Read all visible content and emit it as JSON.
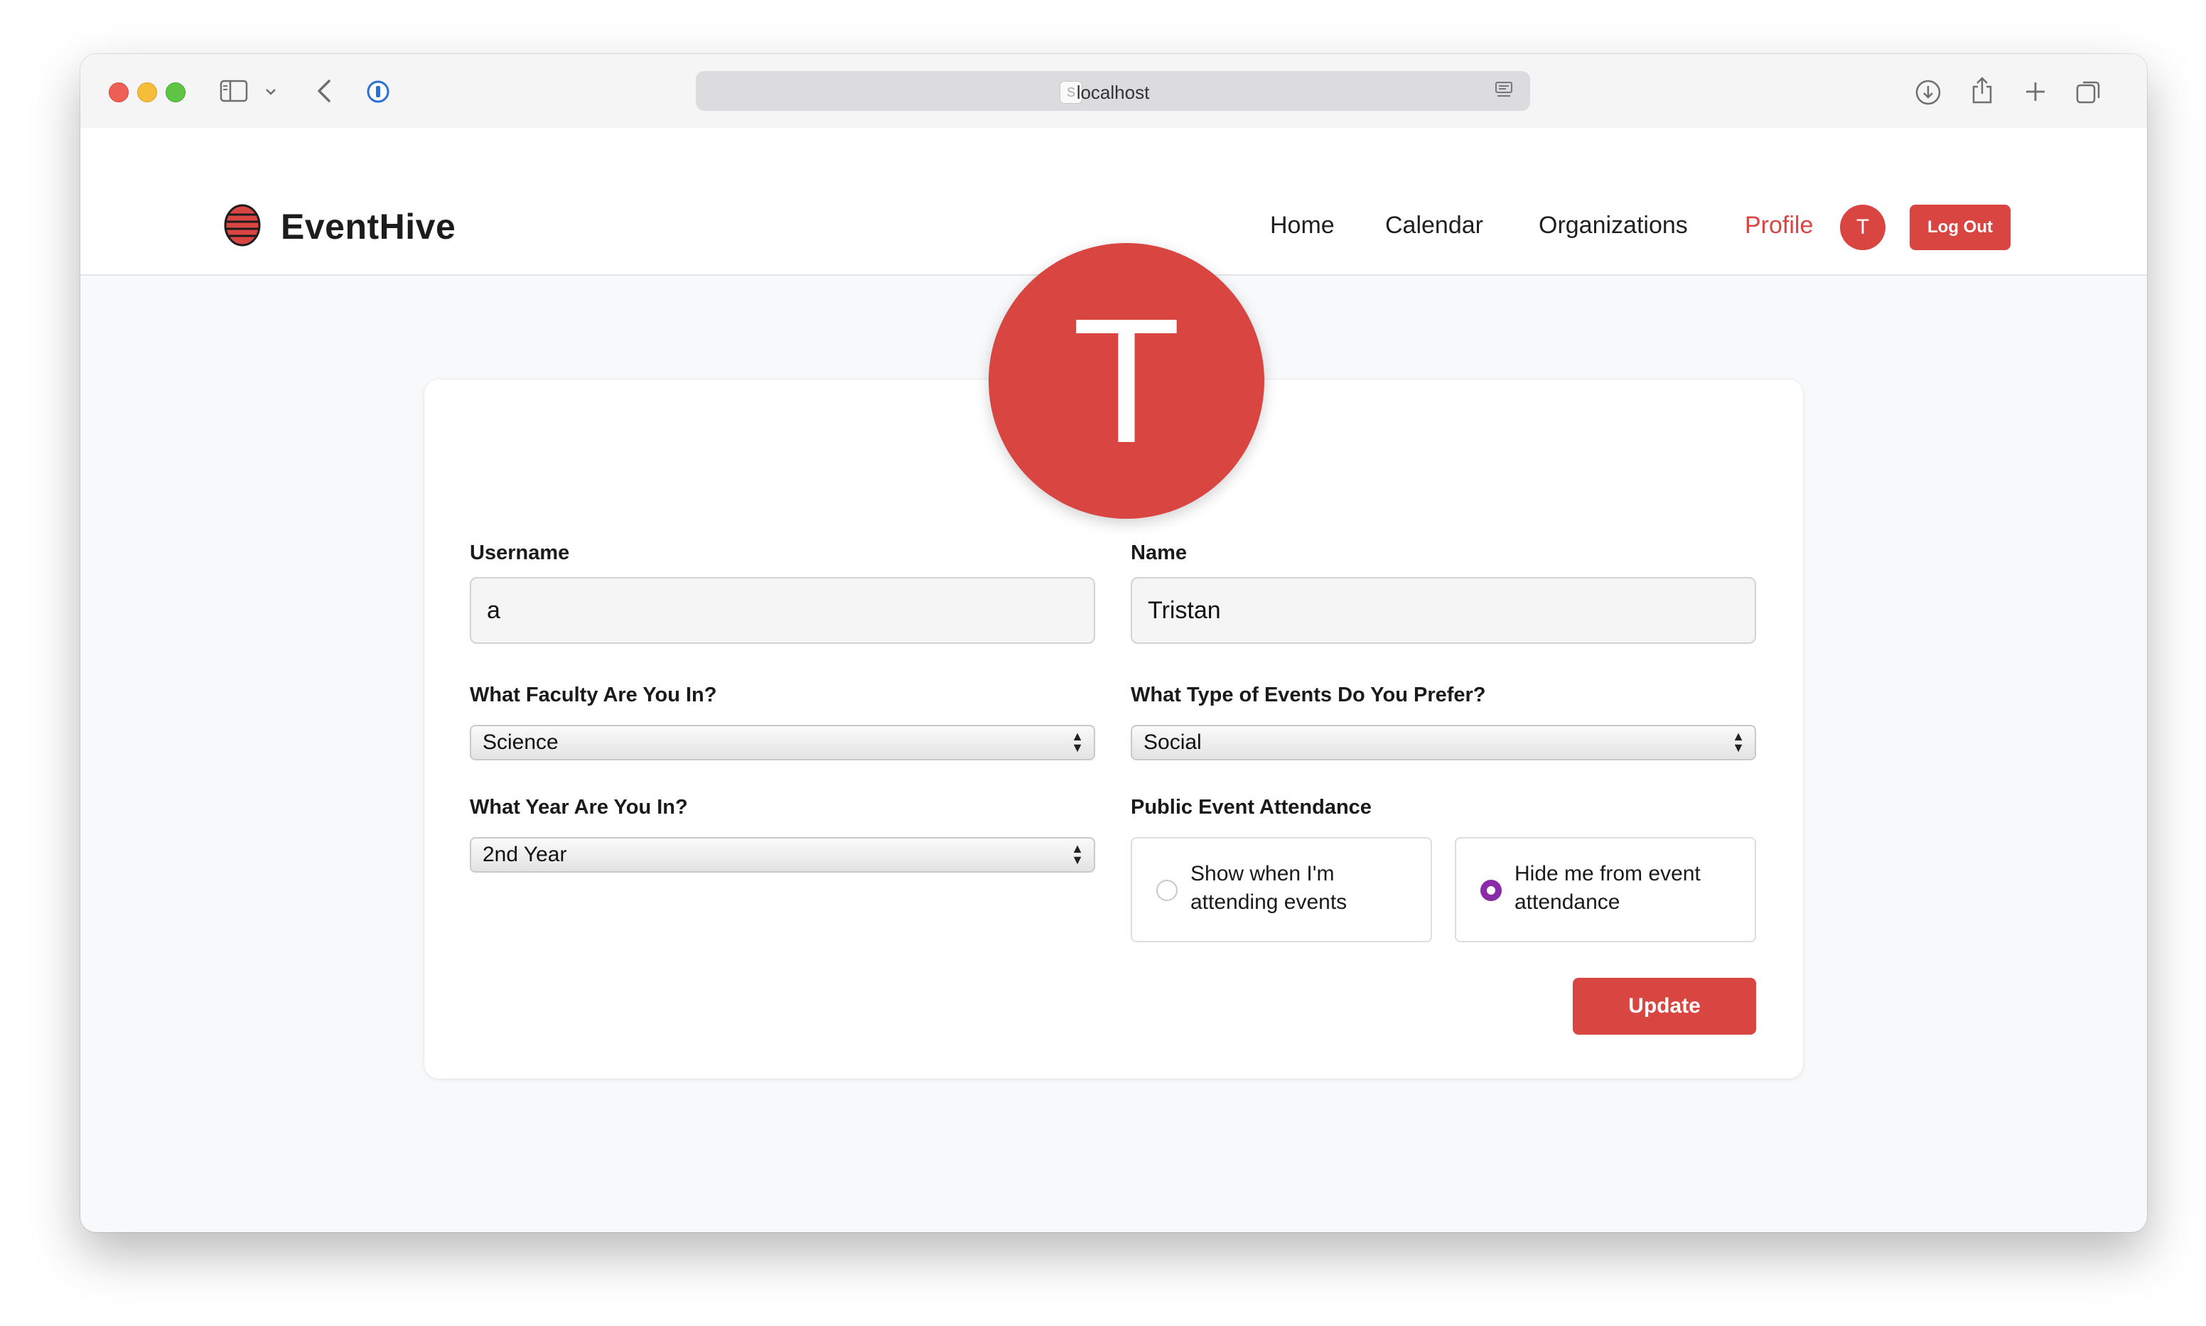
{
  "browser": {
    "url": "localhost"
  },
  "app": {
    "brand": "EventHive",
    "nav": {
      "home": "Home",
      "calendar": "Calendar",
      "organizations": "Organizations",
      "profile": "Profile",
      "avatar_initial": "T",
      "logout": "Log Out"
    },
    "colors": {
      "accent": "#d94541",
      "radio_selected": "#8a2aa7"
    }
  },
  "profile": {
    "avatar_initial": "T",
    "username_label": "Username",
    "username_value": "a",
    "name_label": "Name",
    "name_value": "Tristan",
    "faculty_label": "What Faculty Are You In?",
    "faculty_value": "Science",
    "event_type_label": "What Type of Events Do You Prefer?",
    "event_type_value": "Social",
    "year_label": "What Year Are You In?",
    "year_value": "2nd Year",
    "attendance_label": "Public Event Attendance",
    "attendance_show": "Show when I'm attending events",
    "attendance_hide": "Hide me from event attendance",
    "attendance_selected": "hide",
    "update_label": "Update"
  }
}
